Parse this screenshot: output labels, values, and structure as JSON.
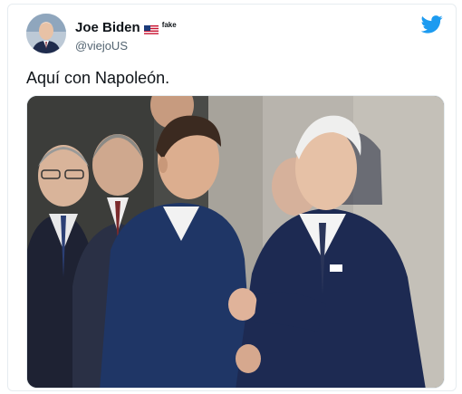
{
  "tweet": {
    "author_name": "Joe Biden",
    "badge_text": "fake",
    "handle": "@viejoUS",
    "text": "Aquí con Napoleón.",
    "icons": {
      "brand": "twitter-bird-icon",
      "flag": "us-flag-icon"
    },
    "colors": {
      "brand": "#1d9bf0",
      "handle": "#536471"
    },
    "photo_subject": "photo"
  }
}
